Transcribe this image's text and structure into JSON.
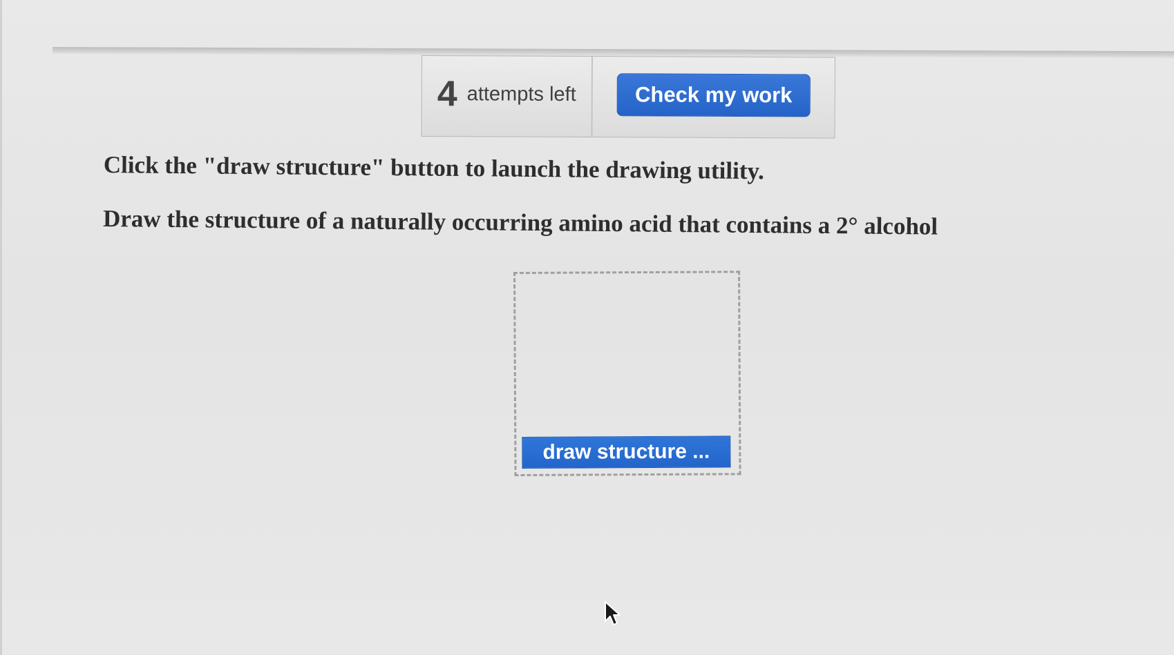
{
  "action_bar": {
    "attempts_count": "4",
    "attempts_label": "attempts left",
    "check_label": "Check my work"
  },
  "instructions": {
    "line1": "Click the \"draw structure\" button to launch the drawing utility.",
    "line2": "Draw the structure of a naturally occurring amino acid that contains a 2° alcohol"
  },
  "drawing": {
    "button_label": "draw structure ..."
  },
  "colors": {
    "accent_blue": "#2a6bd0",
    "background": "#e6e6e6",
    "text": "#2e2e2e"
  },
  "icons": {
    "cursor": "mouse-pointer-icon"
  }
}
